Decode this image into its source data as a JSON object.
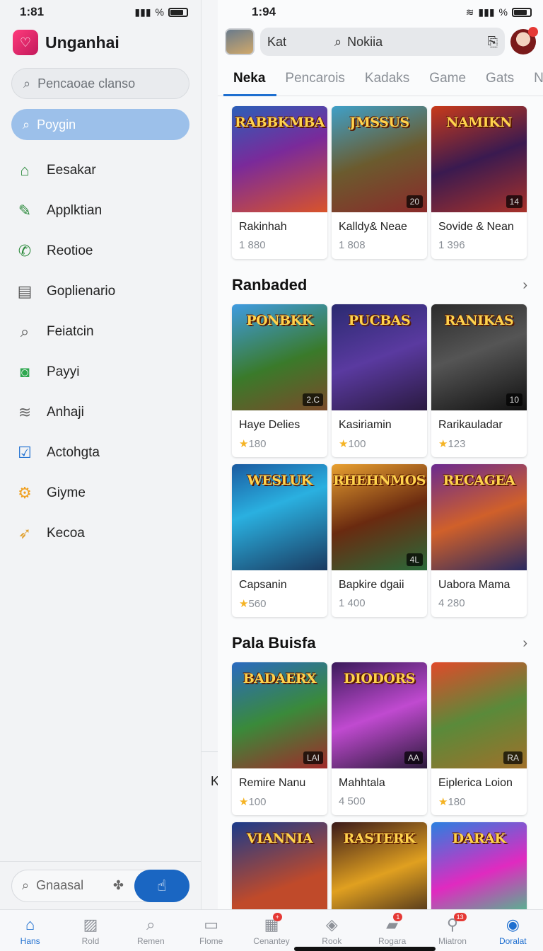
{
  "left": {
    "status": {
      "time": "1:81",
      "right": "%"
    },
    "app_title": "Unganhai",
    "search_placeholder": "Pencaoae clanso",
    "active_item": "Poygin",
    "nav": [
      {
        "icon": "home-icon",
        "glyph": "⌂",
        "color": "#2e8b3e",
        "label": "Eesakar"
      },
      {
        "icon": "pencil-icon",
        "glyph": "✎",
        "color": "#2e8b3e",
        "label": "Applktian"
      },
      {
        "icon": "phone-icon",
        "glyph": "✆",
        "color": "#2e8b3e",
        "label": "Reotioe"
      },
      {
        "icon": "list-icon",
        "glyph": "▤",
        "color": "#555555",
        "label": "Goplienario"
      },
      {
        "icon": "search-icon",
        "glyph": "⌕",
        "color": "#555555",
        "label": "Feiatcin"
      },
      {
        "icon": "camera-icon",
        "glyph": "◙",
        "color": "#2ea84e",
        "label": "Payyi"
      },
      {
        "icon": "wifi-icon",
        "glyph": "≋",
        "color": "#666666",
        "label": "Anhaji"
      },
      {
        "icon": "checkbox-icon",
        "glyph": "☑",
        "color": "#1e6fd0",
        "label": "Actohgta"
      },
      {
        "icon": "gear-icon",
        "glyph": "⚙",
        "color": "#f0a020",
        "label": "Giyme"
      },
      {
        "icon": "rocket-icon",
        "glyph": "➶",
        "color": "#e0a030",
        "label": "Kecoa"
      }
    ],
    "bottom_search": "Gnaasal"
  },
  "right": {
    "status": {
      "time": "1:94",
      "right": "%"
    },
    "search": {
      "left": "Kat",
      "query": "Nokiia"
    },
    "tabs": [
      "Neka",
      "Pencarois",
      "Kadaks",
      "Game",
      "Gats",
      "Na"
    ],
    "top_row": [
      {
        "art": "RABBKMBA",
        "badge": "",
        "name": "Rakinhah",
        "value": "1 880",
        "star": false
      },
      {
        "art": "JMSSUS",
        "badge": "20",
        "name": "Kalldy& Neae",
        "value": "1 808",
        "star": false
      },
      {
        "art": "NAMIKN",
        "badge": "14",
        "name": "Sovide & Nean",
        "value": "1 396",
        "star": false
      }
    ],
    "sections": [
      {
        "title": "Ranbaded",
        "rows": [
          [
            {
              "art": "PONBKK",
              "badge": "2.C",
              "name": "Haye Delies",
              "value": "180",
              "star": true
            },
            {
              "art": "PUCBAS",
              "badge": "",
              "name": "Kasiriamin",
              "value": "100",
              "star": true
            },
            {
              "art": "RANIKAS",
              "badge": "10",
              "name": "Rarikauladar",
              "value": "123",
              "star": true
            }
          ],
          [
            {
              "art": "WESLUK",
              "badge": "",
              "name": "Capsanin",
              "value": "560",
              "star": true
            },
            {
              "art": "RHEHNMOS",
              "badge": "4L",
              "name": "Bapkire dgaii",
              "value": "1 400",
              "star": false
            },
            {
              "art": "RECAGEA",
              "badge": "",
              "name": "Uabora Mama",
              "value": "4 280",
              "star": false
            }
          ]
        ]
      },
      {
        "title": "Pala Buisfa",
        "rows": [
          [
            {
              "art": "BADAERX",
              "badge": "LAI",
              "name": "Remire Nanu",
              "value": "100",
              "star": true
            },
            {
              "art": "DIODORS",
              "badge": "AA",
              "name": "Mahhtala",
              "value": "4 500",
              "star": false
            },
            {
              "art": "",
              "badge": "RA",
              "name": "Eiplerica Loion",
              "value": "180",
              "star": true
            }
          ],
          [
            {
              "art": "VIANNIA",
              "badge": "",
              "name": "",
              "value": "",
              "star": false
            },
            {
              "art": "RASTERK",
              "badge": "",
              "name": "",
              "value": "",
              "star": false
            },
            {
              "art": "DARAK",
              "badge": "",
              "name": "",
              "value": "",
              "star": false
            }
          ]
        ]
      }
    ]
  },
  "stray_letter": "K",
  "bottom_nav": [
    {
      "icon": "home-icon",
      "glyph": "⌂",
      "label": "Hans",
      "active": true,
      "badge": ""
    },
    {
      "icon": "image-icon",
      "glyph": "▨",
      "label": "Rold",
      "active": false,
      "badge": ""
    },
    {
      "icon": "search-icon",
      "glyph": "⌕",
      "label": "Remen",
      "active": false,
      "badge": ""
    },
    {
      "icon": "monitor-icon",
      "glyph": "▭",
      "label": "Flome",
      "active": false,
      "badge": ""
    },
    {
      "icon": "calendar-icon",
      "glyph": "▦",
      "label": "Cenantey",
      "active": false,
      "badge": "+"
    },
    {
      "icon": "box-icon",
      "glyph": "◈",
      "label": "Rook",
      "active": false,
      "badge": ""
    },
    {
      "icon": "bookmark-icon",
      "glyph": "▰",
      "label": "Rogara",
      "active": false,
      "badge": "1"
    },
    {
      "icon": "pin-icon",
      "glyph": "⚲",
      "label": "Miatron",
      "active": false,
      "badge": "13"
    },
    {
      "icon": "user-icon",
      "glyph": "◉",
      "label": "Doralat",
      "active": true,
      "badge": ""
    }
  ]
}
